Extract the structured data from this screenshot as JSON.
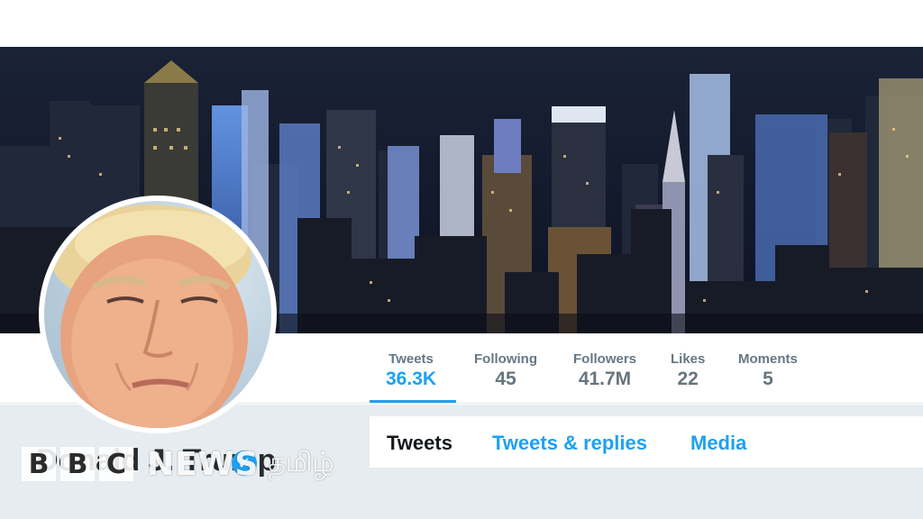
{
  "profile": {
    "name": "Donald J. Trump",
    "verified": true
  },
  "stats": [
    {
      "label": "Tweets",
      "value": "36.3K",
      "active": true
    },
    {
      "label": "Following",
      "value": "45",
      "active": false
    },
    {
      "label": "Followers",
      "value": "41.7M",
      "active": false
    },
    {
      "label": "Likes",
      "value": "22",
      "active": false
    },
    {
      "label": "Moments",
      "value": "5",
      "active": false
    }
  ],
  "tabs": [
    {
      "label": "Tweets",
      "current": true
    },
    {
      "label": "Tweets & replies",
      "current": false
    },
    {
      "label": "Media",
      "current": false
    }
  ],
  "watermark": {
    "letters": [
      "B",
      "B",
      "C"
    ],
    "news": "NEWS",
    "language": "தமிழ்"
  },
  "icons": {
    "verified": "verified-badge-icon"
  },
  "colors": {
    "accent": "#1da1f2",
    "stat_label": "#657786",
    "stat_value": "#66757f",
    "text_dark": "#14171a",
    "page_bg": "#e6ecf0"
  }
}
